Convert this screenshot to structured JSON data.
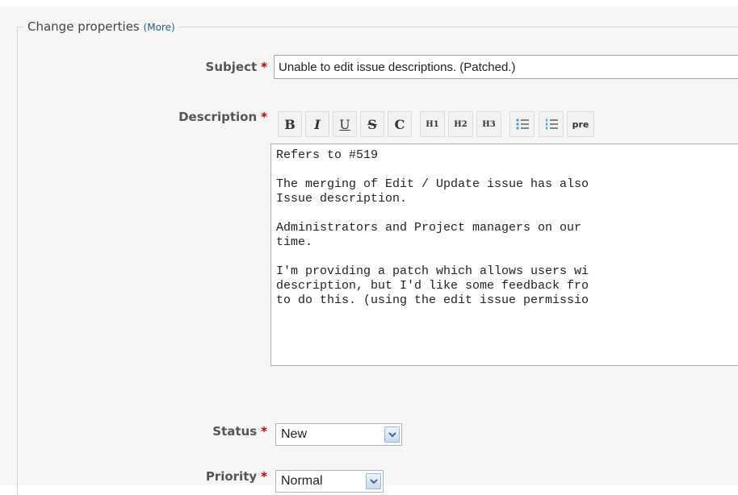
{
  "legend": {
    "title": "Change properties",
    "more_link": "(More)"
  },
  "subject": {
    "label": "Subject",
    "required_mark": "*",
    "value": "Unable to edit issue descriptions. (Patched.)"
  },
  "description": {
    "label": "Description",
    "required_mark": "*",
    "toolbar": [
      "B",
      "I",
      "U",
      "S",
      "C",
      "H1",
      "H2",
      "H3",
      "unordered-list",
      "ordered-list",
      "pre"
    ],
    "toolbar_labels": {
      "bold": "B",
      "italic": "I",
      "underline": "U",
      "strike": "S",
      "code": "C",
      "h1": "H1",
      "h2": "H2",
      "h3": "H3",
      "pre": "pre"
    },
    "lines": [
      "Refers to #519",
      "",
      "The merging of Edit / Update issue has also",
      "Issue description.",
      "",
      "Administrators and Project managers on our",
      "time.",
      "",
      "I'm providing a patch which allows users wi",
      "description, but I'd like some feedback fro",
      "to do this. (using the edit issue permissio"
    ]
  },
  "status": {
    "label": "Status",
    "required_mark": "*",
    "value": "New"
  },
  "priority": {
    "label": "Priority",
    "required_mark": "*",
    "value": "Normal"
  },
  "colors": {
    "required": "#bb0000",
    "link": "#2a5a8a",
    "panel": "#f6f6f6"
  }
}
